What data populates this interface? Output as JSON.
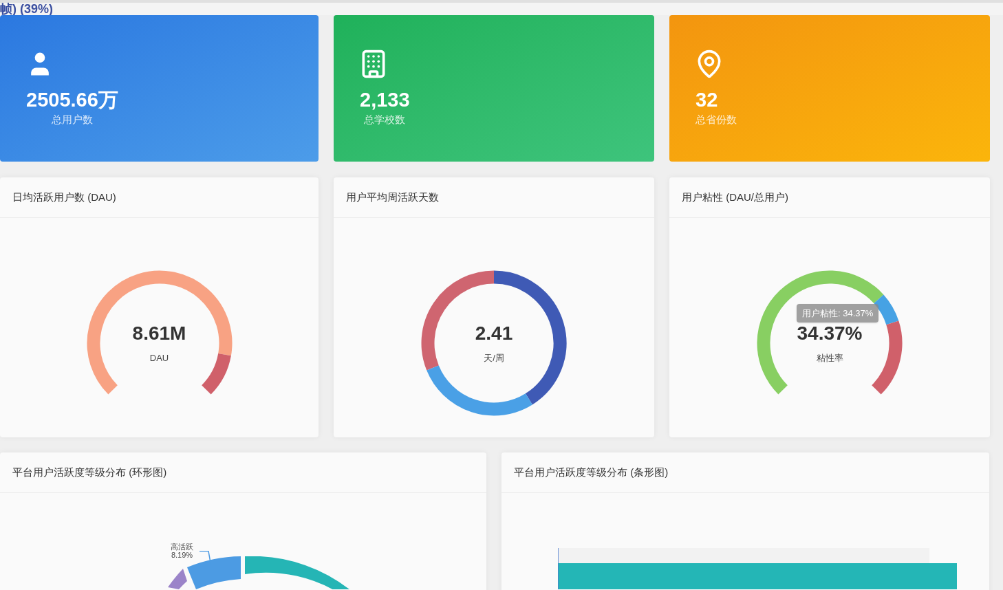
{
  "overlay_caption": "帧) (39%)",
  "stat_cards": [
    {
      "kind": "user",
      "value": "2505.66万",
      "label": "总用户数"
    },
    {
      "kind": "building",
      "value": "2,133",
      "label": "总学校数"
    },
    {
      "kind": "pin",
      "value": "32",
      "label": "总省份数"
    }
  ],
  "gauge_panels": [
    {
      "kind": "gauge",
      "title": "日均活跃用户数 (DAU)",
      "value": "8.61M",
      "unit": "DAU"
    },
    {
      "kind": "ring",
      "title": "用户平均周活跃天数",
      "value": "2.41",
      "unit": "天/周"
    },
    {
      "kind": "sticky",
      "title": "用户粘性 (DAU/总用户)",
      "value": "34.37%",
      "unit": "粘性率",
      "tooltip": "用户粘性: 34.37%"
    }
  ],
  "bottom_panels": [
    {
      "kind": "donut",
      "title": "平台用户活跃度等级分布 (环形图)",
      "slice_label": "高活跃",
      "slice_share": "8.19%"
    },
    {
      "kind": "bars",
      "title": "平台用户活跃度等级分布 (条形图)"
    }
  ]
}
